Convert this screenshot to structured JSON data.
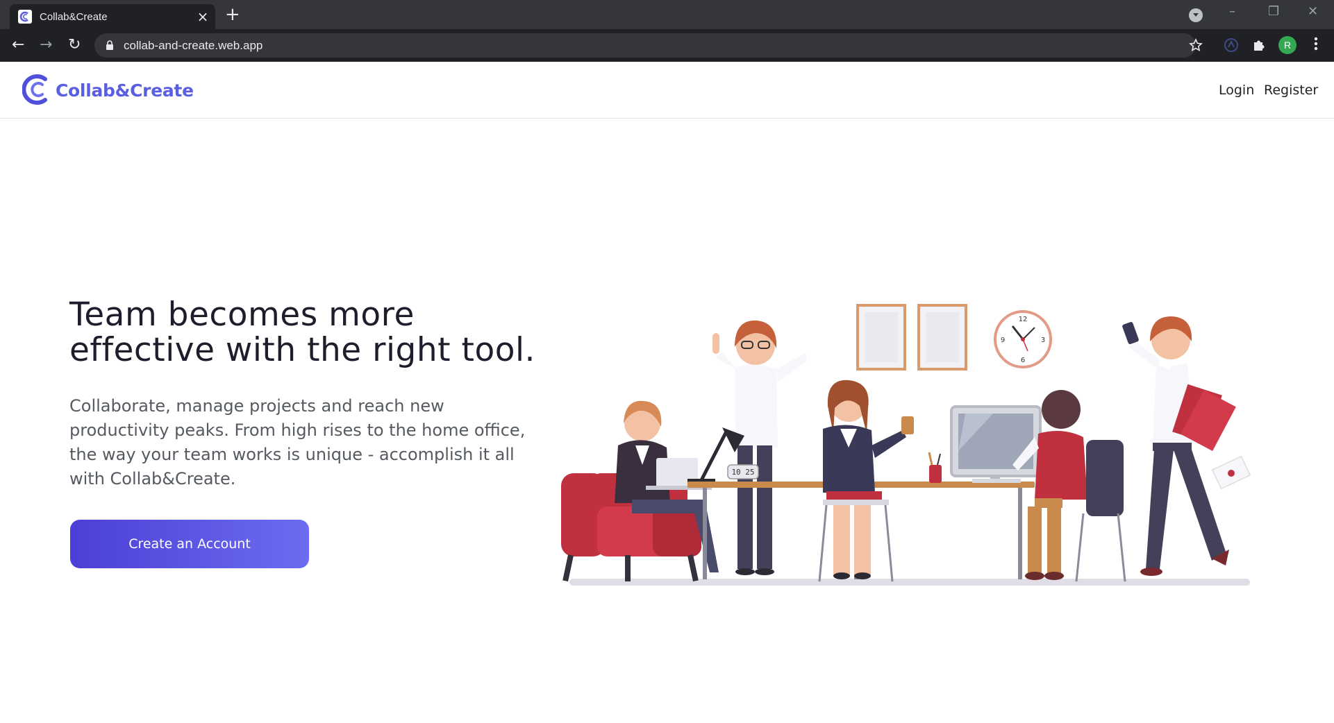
{
  "browser": {
    "tab_title": "Collab&Create",
    "url": "collab-and-create.web.app",
    "profile_initial": "R"
  },
  "site": {
    "brand": "Collab&Create",
    "nav": [
      {
        "label": "Login"
      },
      {
        "label": "Register"
      }
    ]
  },
  "hero": {
    "title_line1": "Team becomes more",
    "title_line2": "effective with the right tool.",
    "text_line1": "Collaborate, manage projects and reach new",
    "text_line2": "productivity peaks. From high rises to the home office,",
    "text_line3": "the way your team works is unique - accomplish it all",
    "text_line4": "with Collab&Create.",
    "cta_label": "Create an Account",
    "clock_display": "10 25"
  },
  "colors": {
    "brand": "#5a5ee0",
    "cta_start": "#4a3fd6",
    "cta_end": "#6c6cf0",
    "accent_red": "#c0303f"
  }
}
